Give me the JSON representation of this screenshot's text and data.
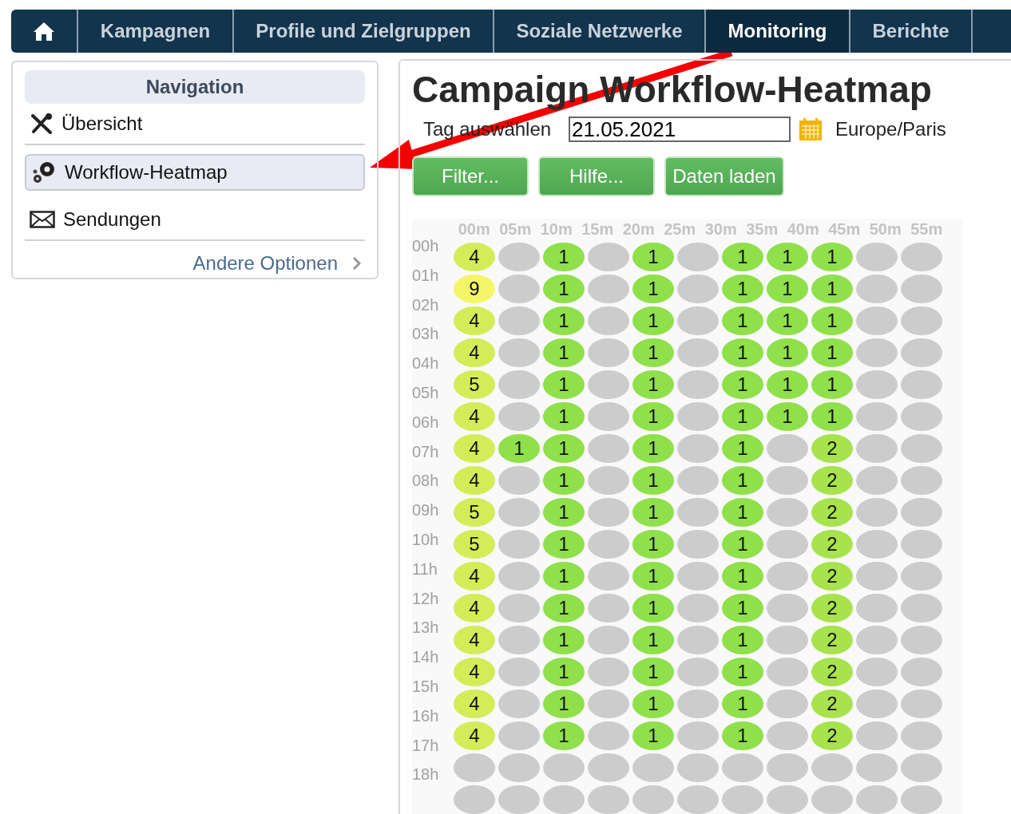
{
  "top_nav": {
    "tabs": [
      {
        "kind": "home",
        "selected": false
      },
      {
        "label": "Kampagnen",
        "selected": false
      },
      {
        "label": "Profile und Zielgruppen",
        "selected": false
      },
      {
        "label": "Soziale Netzwerke",
        "selected": false
      },
      {
        "label": "Monitoring",
        "selected": true
      },
      {
        "label": "Berichte",
        "selected": false
      }
    ]
  },
  "sidebar": {
    "title": "Navigation",
    "items": [
      {
        "label": "Übersicht",
        "kind": "tools",
        "selected": false
      },
      {
        "label": "Workflow-Heatmap",
        "kind": "gears",
        "selected": true
      },
      {
        "label": "Sendungen",
        "kind": "envelope",
        "selected": false
      }
    ],
    "more_link": "Andere Optionen"
  },
  "main": {
    "title": "Campaign Workflow-Heatmap",
    "date_label": "Tag auswählen",
    "date_value": "21.05.2021",
    "timezone": "Europe/Paris",
    "buttons": [
      "Filter...",
      "Hilfe...",
      "Daten laden"
    ]
  },
  "heatmap": {
    "columns": [
      "00m",
      "05m",
      "10m",
      "15m",
      "20m",
      "25m",
      "30m",
      "35m",
      "40m",
      "45m",
      "50m",
      "55m"
    ],
    "hours": [
      "00h",
      "01h",
      "02h",
      "03h",
      "04h",
      "05h",
      "06h",
      "07h",
      "08h",
      "09h",
      "10h",
      "11h",
      "12h",
      "13h",
      "14h",
      "15h",
      "16h",
      "17h",
      "18h"
    ],
    "rows": [
      [
        {
          "value": "4",
          "color": "#d4ec58"
        },
        {
          "color": "#cccccc"
        },
        {
          "value": "1",
          "color": "#8fe04a"
        },
        {
          "color": "#cccccc"
        },
        {
          "value": "1",
          "color": "#8fe04a"
        },
        {
          "color": "#cccccc"
        },
        {
          "value": "1",
          "color": "#8fe04a"
        },
        {
          "value": "1",
          "color": "#8fe04a"
        },
        {
          "value": "1",
          "color": "#8fe04a"
        },
        {
          "color": "#cccccc"
        },
        {
          "color": "#cccccc"
        }
      ],
      [
        {
          "value": "9",
          "color": "#f5f56a"
        },
        {
          "color": "#cccccc"
        },
        {
          "value": "1",
          "color": "#8fe04a"
        },
        {
          "color": "#cccccc"
        },
        {
          "value": "1",
          "color": "#8fe04a"
        },
        {
          "color": "#cccccc"
        },
        {
          "value": "1",
          "color": "#8fe04a"
        },
        {
          "value": "1",
          "color": "#8fe04a"
        },
        {
          "value": "1",
          "color": "#8fe04a"
        },
        {
          "color": "#cccccc"
        },
        {
          "color": "#cccccc"
        }
      ],
      [
        {
          "value": "4",
          "color": "#d4ec58"
        },
        {
          "color": "#cccccc"
        },
        {
          "value": "1",
          "color": "#8fe04a"
        },
        {
          "color": "#cccccc"
        },
        {
          "value": "1",
          "color": "#8fe04a"
        },
        {
          "color": "#cccccc"
        },
        {
          "value": "1",
          "color": "#8fe04a"
        },
        {
          "value": "1",
          "color": "#8fe04a"
        },
        {
          "value": "1",
          "color": "#8fe04a"
        },
        {
          "color": "#cccccc"
        },
        {
          "color": "#cccccc"
        }
      ],
      [
        {
          "value": "4",
          "color": "#d4ec58"
        },
        {
          "color": "#cccccc"
        },
        {
          "value": "1",
          "color": "#8fe04a"
        },
        {
          "color": "#cccccc"
        },
        {
          "value": "1",
          "color": "#8fe04a"
        },
        {
          "color": "#cccccc"
        },
        {
          "value": "1",
          "color": "#8fe04a"
        },
        {
          "value": "1",
          "color": "#8fe04a"
        },
        {
          "value": "1",
          "color": "#8fe04a"
        },
        {
          "color": "#cccccc"
        },
        {
          "color": "#cccccc"
        }
      ],
      [
        {
          "value": "5",
          "color": "#d4ec58"
        },
        {
          "color": "#cccccc"
        },
        {
          "value": "1",
          "color": "#8fe04a"
        },
        {
          "color": "#cccccc"
        },
        {
          "value": "1",
          "color": "#8fe04a"
        },
        {
          "color": "#cccccc"
        },
        {
          "value": "1",
          "color": "#8fe04a"
        },
        {
          "value": "1",
          "color": "#8fe04a"
        },
        {
          "value": "1",
          "color": "#8fe04a"
        },
        {
          "color": "#cccccc"
        },
        {
          "color": "#cccccc"
        }
      ],
      [
        {
          "value": "4",
          "color": "#d4ec58"
        },
        {
          "color": "#cccccc"
        },
        {
          "value": "1",
          "color": "#8fe04a"
        },
        {
          "color": "#cccccc"
        },
        {
          "value": "1",
          "color": "#8fe04a"
        },
        {
          "color": "#cccccc"
        },
        {
          "value": "1",
          "color": "#8fe04a"
        },
        {
          "value": "1",
          "color": "#8fe04a"
        },
        {
          "value": "1",
          "color": "#8fe04a"
        },
        {
          "color": "#cccccc"
        },
        {
          "color": "#cccccc"
        }
      ],
      [
        {
          "value": "4",
          "color": "#d4ec58"
        },
        {
          "value": "1",
          "color": "#8fe04a"
        },
        {
          "value": "1",
          "color": "#8fe04a"
        },
        {
          "color": "#cccccc"
        },
        {
          "value": "1",
          "color": "#8fe04a"
        },
        {
          "color": "#cccccc"
        },
        {
          "value": "1",
          "color": "#8fe04a"
        },
        {
          "color": "#cccccc"
        },
        {
          "value": "2",
          "color": "#a8e24c"
        },
        {
          "color": "#cccccc"
        },
        {
          "color": "#cccccc"
        }
      ],
      [
        {
          "value": "4",
          "color": "#d4ec58"
        },
        {
          "color": "#cccccc"
        },
        {
          "value": "1",
          "color": "#8fe04a"
        },
        {
          "color": "#cccccc"
        },
        {
          "value": "1",
          "color": "#8fe04a"
        },
        {
          "color": "#cccccc"
        },
        {
          "value": "1",
          "color": "#8fe04a"
        },
        {
          "color": "#cccccc"
        },
        {
          "value": "2",
          "color": "#a8e24c"
        },
        {
          "color": "#cccccc"
        },
        {
          "color": "#cccccc"
        }
      ],
      [
        {
          "value": "5",
          "color": "#d4ec58"
        },
        {
          "color": "#cccccc"
        },
        {
          "value": "1",
          "color": "#8fe04a"
        },
        {
          "color": "#cccccc"
        },
        {
          "value": "1",
          "color": "#8fe04a"
        },
        {
          "color": "#cccccc"
        },
        {
          "value": "1",
          "color": "#8fe04a"
        },
        {
          "color": "#cccccc"
        },
        {
          "value": "2",
          "color": "#a8e24c"
        },
        {
          "color": "#cccccc"
        },
        {
          "color": "#cccccc"
        }
      ],
      [
        {
          "value": "5",
          "color": "#d4ec58"
        },
        {
          "color": "#cccccc"
        },
        {
          "value": "1",
          "color": "#8fe04a"
        },
        {
          "color": "#cccccc"
        },
        {
          "value": "1",
          "color": "#8fe04a"
        },
        {
          "color": "#cccccc"
        },
        {
          "value": "1",
          "color": "#8fe04a"
        },
        {
          "color": "#cccccc"
        },
        {
          "value": "2",
          "color": "#a8e24c"
        },
        {
          "color": "#cccccc"
        },
        {
          "color": "#cccccc"
        }
      ],
      [
        {
          "value": "4",
          "color": "#d4ec58"
        },
        {
          "color": "#cccccc"
        },
        {
          "value": "1",
          "color": "#8fe04a"
        },
        {
          "color": "#cccccc"
        },
        {
          "value": "1",
          "color": "#8fe04a"
        },
        {
          "color": "#cccccc"
        },
        {
          "value": "1",
          "color": "#8fe04a"
        },
        {
          "color": "#cccccc"
        },
        {
          "value": "2",
          "color": "#a8e24c"
        },
        {
          "color": "#cccccc"
        },
        {
          "color": "#cccccc"
        }
      ],
      [
        {
          "value": "4",
          "color": "#d4ec58"
        },
        {
          "color": "#cccccc"
        },
        {
          "value": "1",
          "color": "#8fe04a"
        },
        {
          "color": "#cccccc"
        },
        {
          "value": "1",
          "color": "#8fe04a"
        },
        {
          "color": "#cccccc"
        },
        {
          "value": "1",
          "color": "#8fe04a"
        },
        {
          "color": "#cccccc"
        },
        {
          "value": "2",
          "color": "#a8e24c"
        },
        {
          "color": "#cccccc"
        },
        {
          "color": "#cccccc"
        }
      ],
      [
        {
          "value": "4",
          "color": "#d4ec58"
        },
        {
          "color": "#cccccc"
        },
        {
          "value": "1",
          "color": "#8fe04a"
        },
        {
          "color": "#cccccc"
        },
        {
          "value": "1",
          "color": "#8fe04a"
        },
        {
          "color": "#cccccc"
        },
        {
          "value": "1",
          "color": "#8fe04a"
        },
        {
          "color": "#cccccc"
        },
        {
          "value": "2",
          "color": "#a8e24c"
        },
        {
          "color": "#cccccc"
        },
        {
          "color": "#cccccc"
        }
      ],
      [
        {
          "value": "4",
          "color": "#d4ec58"
        },
        {
          "color": "#cccccc"
        },
        {
          "value": "1",
          "color": "#8fe04a"
        },
        {
          "color": "#cccccc"
        },
        {
          "value": "1",
          "color": "#8fe04a"
        },
        {
          "color": "#cccccc"
        },
        {
          "value": "1",
          "color": "#8fe04a"
        },
        {
          "color": "#cccccc"
        },
        {
          "value": "2",
          "color": "#a8e24c"
        },
        {
          "color": "#cccccc"
        },
        {
          "color": "#cccccc"
        }
      ],
      [
        {
          "value": "4",
          "color": "#d4ec58"
        },
        {
          "color": "#cccccc"
        },
        {
          "value": "1",
          "color": "#8fe04a"
        },
        {
          "color": "#cccccc"
        },
        {
          "value": "1",
          "color": "#8fe04a"
        },
        {
          "color": "#cccccc"
        },
        {
          "value": "1",
          "color": "#8fe04a"
        },
        {
          "color": "#cccccc"
        },
        {
          "value": "2",
          "color": "#a8e24c"
        },
        {
          "color": "#cccccc"
        },
        {
          "color": "#cccccc"
        }
      ],
      [
        {
          "value": "4",
          "color": "#d4ec58"
        },
        {
          "color": "#cccccc"
        },
        {
          "value": "1",
          "color": "#8fe04a"
        },
        {
          "color": "#cccccc"
        },
        {
          "value": "1",
          "color": "#8fe04a"
        },
        {
          "color": "#cccccc"
        },
        {
          "value": "1",
          "color": "#8fe04a"
        },
        {
          "color": "#cccccc"
        },
        {
          "value": "2",
          "color": "#a8e24c"
        },
        {
          "color": "#cccccc"
        },
        {
          "color": "#cccccc"
        }
      ],
      [
        {
          "color": "#cccccc"
        },
        {
          "color": "#cccccc"
        },
        {
          "color": "#cccccc"
        },
        {
          "color": "#cccccc"
        },
        {
          "color": "#cccccc"
        },
        {
          "color": "#cccccc"
        },
        {
          "color": "#cccccc"
        },
        {
          "color": "#cccccc"
        },
        {
          "color": "#cccccc"
        },
        {
          "color": "#cccccc"
        },
        {
          "color": "#cccccc"
        }
      ],
      [
        {
          "color": "#cccccc"
        },
        {
          "color": "#cccccc"
        },
        {
          "color": "#cccccc"
        },
        {
          "color": "#cccccc"
        },
        {
          "color": "#cccccc"
        },
        {
          "color": "#cccccc"
        },
        {
          "color": "#cccccc"
        },
        {
          "color": "#cccccc"
        },
        {
          "color": "#cccccc"
        },
        {
          "color": "#cccccc"
        },
        {
          "color": "#cccccc"
        }
      ]
    ]
  }
}
